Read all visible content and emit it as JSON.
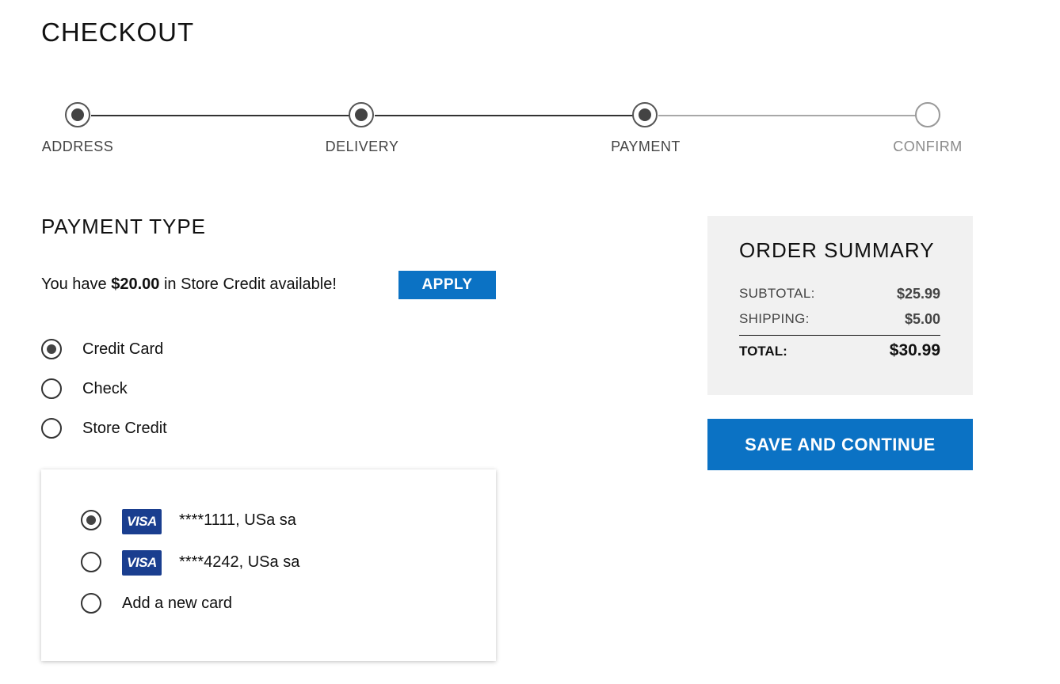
{
  "page": {
    "title": "CHECKOUT"
  },
  "steps": [
    {
      "label": "ADDRESS",
      "status": "complete"
    },
    {
      "label": "DELIVERY",
      "status": "complete"
    },
    {
      "label": "PAYMENT",
      "status": "complete"
    },
    {
      "label": "CONFIRM",
      "status": "pending"
    }
  ],
  "payment": {
    "section_title": "PAYMENT TYPE",
    "store_credit_prefix": "You have",
    "store_credit_amount": "$20.00",
    "store_credit_suffix": "in Store Credit available!",
    "apply_label": "APPLY",
    "types": [
      {
        "label": "Credit Card",
        "selected": true
      },
      {
        "label": "Check",
        "selected": false
      },
      {
        "label": "Store Credit",
        "selected": false
      }
    ],
    "cards": [
      {
        "brand": "VISA",
        "label": "****1111,  USa sa",
        "selected": true
      },
      {
        "brand": "VISA",
        "label": "****4242,  USa sa",
        "selected": false
      }
    ],
    "add_card_label": "Add a new card"
  },
  "summary": {
    "title": "ORDER SUMMARY",
    "subtotal_label": "SUBTOTAL:",
    "subtotal_value": "$25.99",
    "shipping_label": "SHIPPING:",
    "shipping_value": "$5.00",
    "total_label": "TOTAL:",
    "total_value": "$30.99"
  },
  "save_label": "SAVE AND CONTINUE",
  "colors": {
    "accent": "#0b72c4",
    "visa": "#1a3e8f",
    "summary_bg": "#f1f1f1"
  }
}
